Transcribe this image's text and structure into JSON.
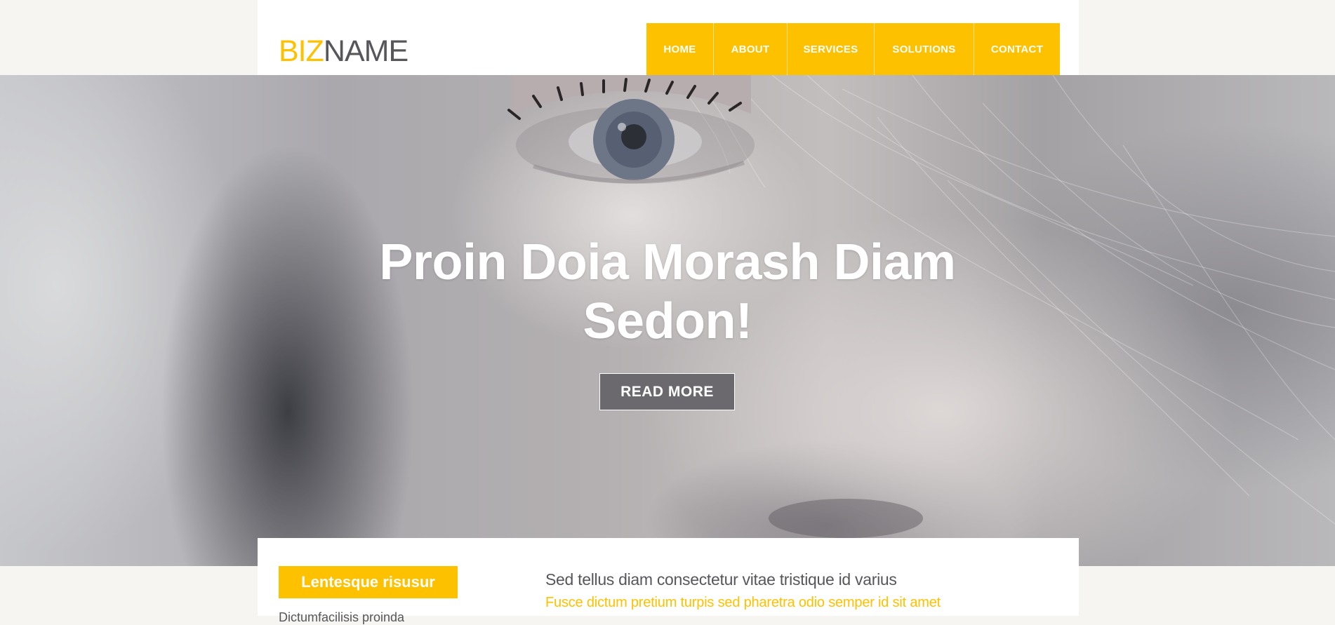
{
  "colors": {
    "accent": "#fec100",
    "text": "#57565b",
    "background": "#f6f5f1",
    "button_bg": "#6b696e"
  },
  "header": {
    "logo_part1": "BIZ",
    "logo_part2": "NAME"
  },
  "nav": {
    "items": [
      {
        "label": "HOME"
      },
      {
        "label": "ABOUT"
      },
      {
        "label": "SERVICES"
      },
      {
        "label": "SOLUTIONS"
      },
      {
        "label": "CONTACT"
      }
    ]
  },
  "hero": {
    "title_line1": "Proin Doia Morash Diam",
    "title_line2": "Sedon!",
    "button_label": "READ MORE"
  },
  "content": {
    "side_badge": "Lentesque risusur",
    "side_text": "Dictumfacilisis proinda",
    "heading": "Sed tellus diam consectetur vitae tristique id varius",
    "subheading": "Fusce dictum pretium turpis sed pharetra odio semper id sit amet"
  }
}
